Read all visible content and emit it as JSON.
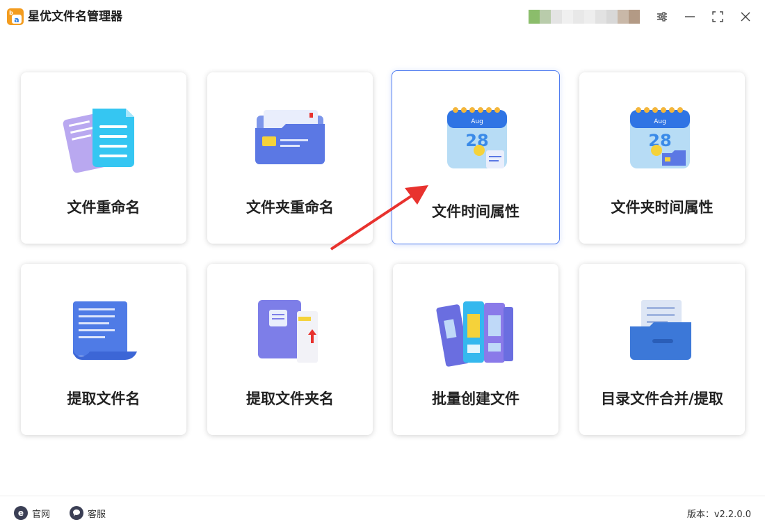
{
  "app": {
    "title": "星优文件名管理器"
  },
  "cards": [
    {
      "label": "文件重命名",
      "icon": "documents-icon"
    },
    {
      "label": "文件夹重命名",
      "icon": "folder-rename-icon"
    },
    {
      "label": "文件时间属性",
      "icon": "calendar-file-icon"
    },
    {
      "label": "文件夹时间属性",
      "icon": "calendar-folder-icon"
    },
    {
      "label": "提取文件名",
      "icon": "scroll-list-icon"
    },
    {
      "label": "提取文件夹名",
      "icon": "folder-extract-icon"
    },
    {
      "label": "批量创建文件",
      "icon": "binders-icon"
    },
    {
      "label": "目录文件合并/提取",
      "icon": "file-drawer-icon"
    }
  ],
  "calendar": {
    "month": "Aug",
    "day": "28"
  },
  "footer": {
    "website_label": "官网",
    "service_label": "客服",
    "version": "版本：v2.2.0.0"
  },
  "colors": {
    "accent": "#4f7cf0",
    "arrow": "#e8322e",
    "logo": "#f39c1f"
  }
}
